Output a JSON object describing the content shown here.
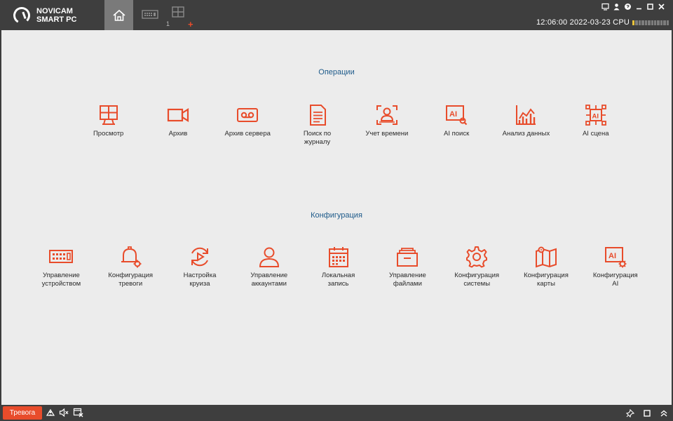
{
  "app": {
    "logo_line1": "NOVICAM",
    "logo_line2": "SMART PC"
  },
  "tabs": [
    {
      "icon": "home-icon",
      "active": true
    },
    {
      "icon": "device-icon",
      "active": false
    },
    {
      "icon": "view-grid-icon",
      "active": false,
      "count": "1",
      "add": "+"
    }
  ],
  "status": {
    "time": "12:06:00 2022-03-23",
    "cpu_label": "CPU",
    "cpu_level": 0.1
  },
  "colors": {
    "accent": "#e84c2b",
    "section_title": "#1d5a8a",
    "bar": "#3e3e3e",
    "background": "#ececec"
  },
  "operations": {
    "title": "Операции",
    "items": [
      {
        "label": "Просмотр",
        "icon": "live-view-icon"
      },
      {
        "label": "Архив",
        "icon": "video-camera-icon"
      },
      {
        "label": "Архив сервера",
        "icon": "tape-icon"
      },
      {
        "label": "Поиск по\nжурналу",
        "icon": "log-document-icon"
      },
      {
        "label": "Учет времени",
        "icon": "face-attendance-icon"
      },
      {
        "label": "AI поиск",
        "icon": "ai-search-icon"
      },
      {
        "label": "Анализ данных",
        "icon": "data-chart-icon"
      },
      {
        "label": "AI сцена",
        "icon": "ai-scene-icon"
      }
    ]
  },
  "configuration": {
    "title": "Конфигурация",
    "items": [
      {
        "label": "Управление\nустройством",
        "icon": "device-manage-icon"
      },
      {
        "label": "Конфигурация\nтревоги",
        "icon": "alarm-bell-icon"
      },
      {
        "label": "Настройка\nкруиза",
        "icon": "cruise-icon"
      },
      {
        "label": "Управление\nаккаунтами",
        "icon": "user-icon"
      },
      {
        "label": "Локальная\nзапись",
        "icon": "calendar-icon"
      },
      {
        "label": "Управление\nфайлами",
        "icon": "folder-icon"
      },
      {
        "label": "Конфигурация\nсистемы",
        "icon": "gear-icon"
      },
      {
        "label": "Конфигурация\nкарты",
        "icon": "map-icon"
      },
      {
        "label": "Конфигурация\nAI",
        "icon": "ai-config-icon"
      }
    ]
  },
  "bottom": {
    "alarm_label": "Тревога"
  }
}
